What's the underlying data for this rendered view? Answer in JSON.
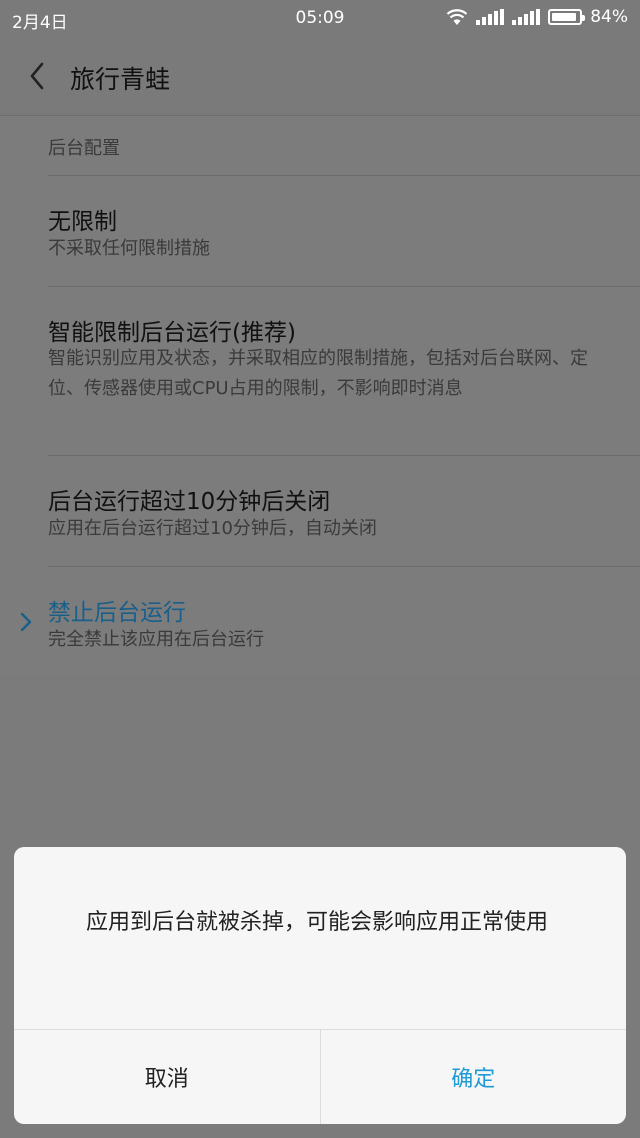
{
  "status_bar": {
    "date": "2月4日",
    "time": "05:09",
    "battery": "84%"
  },
  "app_bar": {
    "title": "旅行青蛙"
  },
  "section": {
    "header": "后台配置"
  },
  "options": [
    {
      "title": "无限制",
      "desc": "不采取任何限制措施"
    },
    {
      "title": "智能限制后台运行(推荐)",
      "desc": "智能识别应用及状态，并采取相应的限制措施，包括对后台联网、定位、传感器使用或CPU占用的限制，不影响即时消息"
    },
    {
      "title": "后台运行超过10分钟后关闭",
      "desc": "应用在后台运行超过10分钟后，自动关闭"
    },
    {
      "title": "禁止后台运行",
      "desc": "完全禁止该应用在后台运行"
    }
  ],
  "dialog": {
    "message": "应用到后台就被杀掉，可能会影响应用正常使用",
    "cancel_label": "取消",
    "ok_label": "确定"
  },
  "colors": {
    "accent": "#1e9ad6",
    "selected_title": "#1a5f8a"
  }
}
